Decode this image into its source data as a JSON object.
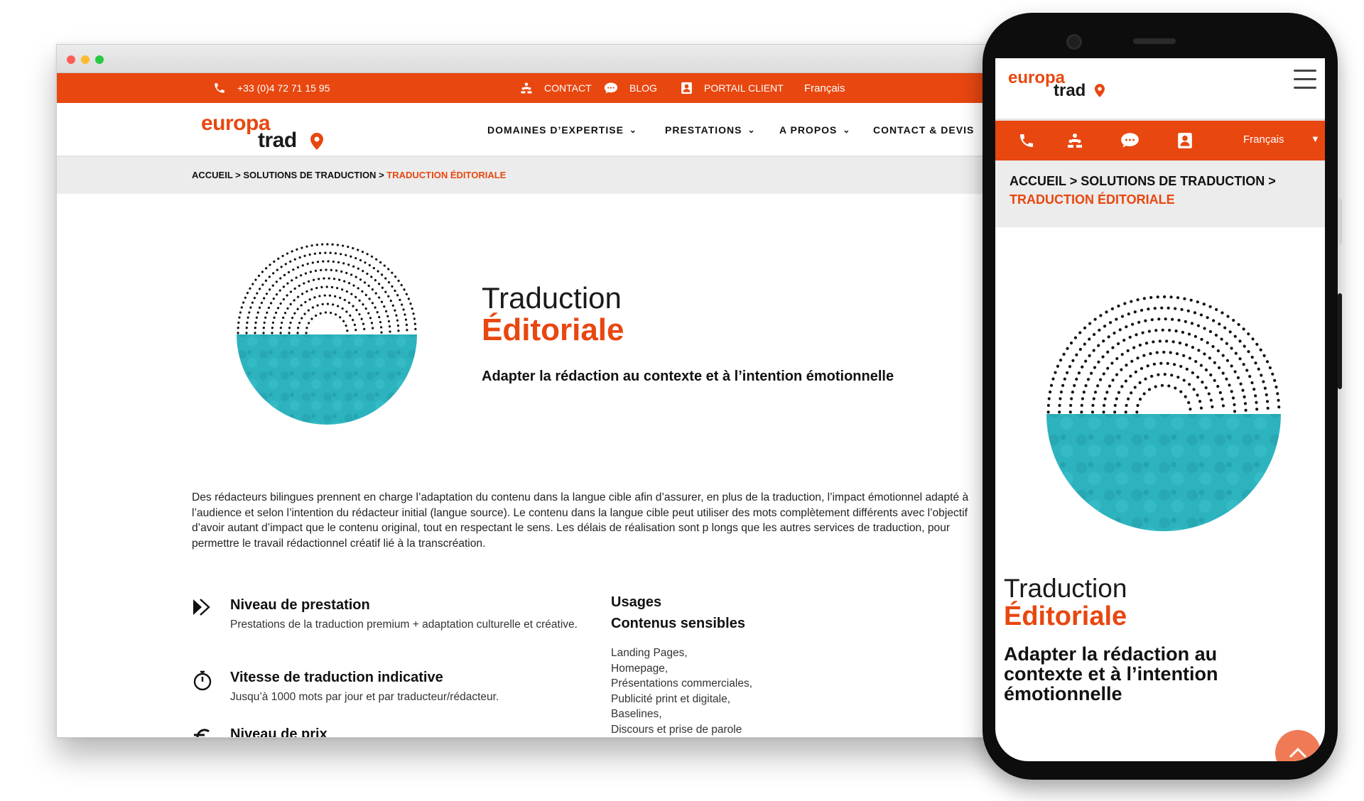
{
  "desktop": {
    "topbar": {
      "phone": "+33 (0)4 72 71 15 95",
      "contact": "CONTACT",
      "blog": "BLOG",
      "portal": "PORTAIL CLIENT",
      "language": "Français"
    },
    "logo": {
      "line1": "europa",
      "line2": "trad"
    },
    "nav": {
      "expertise": "DOMAINES D’EXPERTISE",
      "prestations": "PRESTATIONS",
      "about": "A PROPOS",
      "contact": "CONTACT & DEVIS"
    },
    "breadcrumb": {
      "home": "ACCUEIL",
      "sep": ">",
      "solutions": "SOLUTIONS DE TRADUCTION",
      "current": "TRADUCTION ÉDITORIALE"
    },
    "hero": {
      "title_line1": "Traduction",
      "title_line2": "Éditoriale",
      "subtitle": "Adapter la rédaction au contexte et à l’intention émotionnelle"
    },
    "description": "Des rédacteurs bilingues prennent en charge l’adaptation du contenu dans la langue cible afin d’assurer, en plus de la traduction, l’impact émotionnel adapté à l’audience et selon l’intention du rédacteur initial (langue source). Le contenu dans la langue cible peut utiliser des mots complètement différents avec l’objectif d’avoir autant d’impact que le contenu original, tout en respectant le sens. Les délais de réalisation sont p longs que les autres services de traduction, pour permettre le travail rédactionnel créatif lié à la transcréation.",
    "features": [
      {
        "title": "Niveau de prestation",
        "text": "Prestations de la traduction premium + adaptation culturelle et créative.",
        "icon": "fast-forward-icon"
      },
      {
        "title": "Vitesse de traduction indicative",
        "text": "Jusqu’à 1000 mots par jour et par traducteur/rédacteur.",
        "icon": "stopwatch-icon"
      },
      {
        "title": "Niveau de prix",
        "text": "",
        "icon": "euro-icon"
      }
    ],
    "usages": {
      "title": "Usages",
      "subtitle": "Contenus sensibles",
      "items": [
        "Landing Pages,",
        "Homepage,",
        "Présentations commerciales,",
        "Publicité print et digitale,",
        "Baselines,",
        "Discours et prise de parole"
      ]
    }
  },
  "mobile": {
    "logo": {
      "line1": "europa",
      "line2": "trad"
    },
    "language": "Français",
    "breadcrumb": {
      "home": "ACCUEIL",
      "solutions": "SOLUTIONS DE TRADUCTION",
      "current": "TRADUCTION ÉDITORIALE"
    },
    "hero": {
      "title_line1": "Traduction",
      "title_line2": "Éditoriale",
      "subtitle": "Adapter la rédaction au contexte et à l’intention émotionnelle"
    }
  },
  "colors": {
    "brand_orange": "#e84710",
    "teal": "#2cb3be",
    "breadcrumb_bg": "#ececec"
  }
}
